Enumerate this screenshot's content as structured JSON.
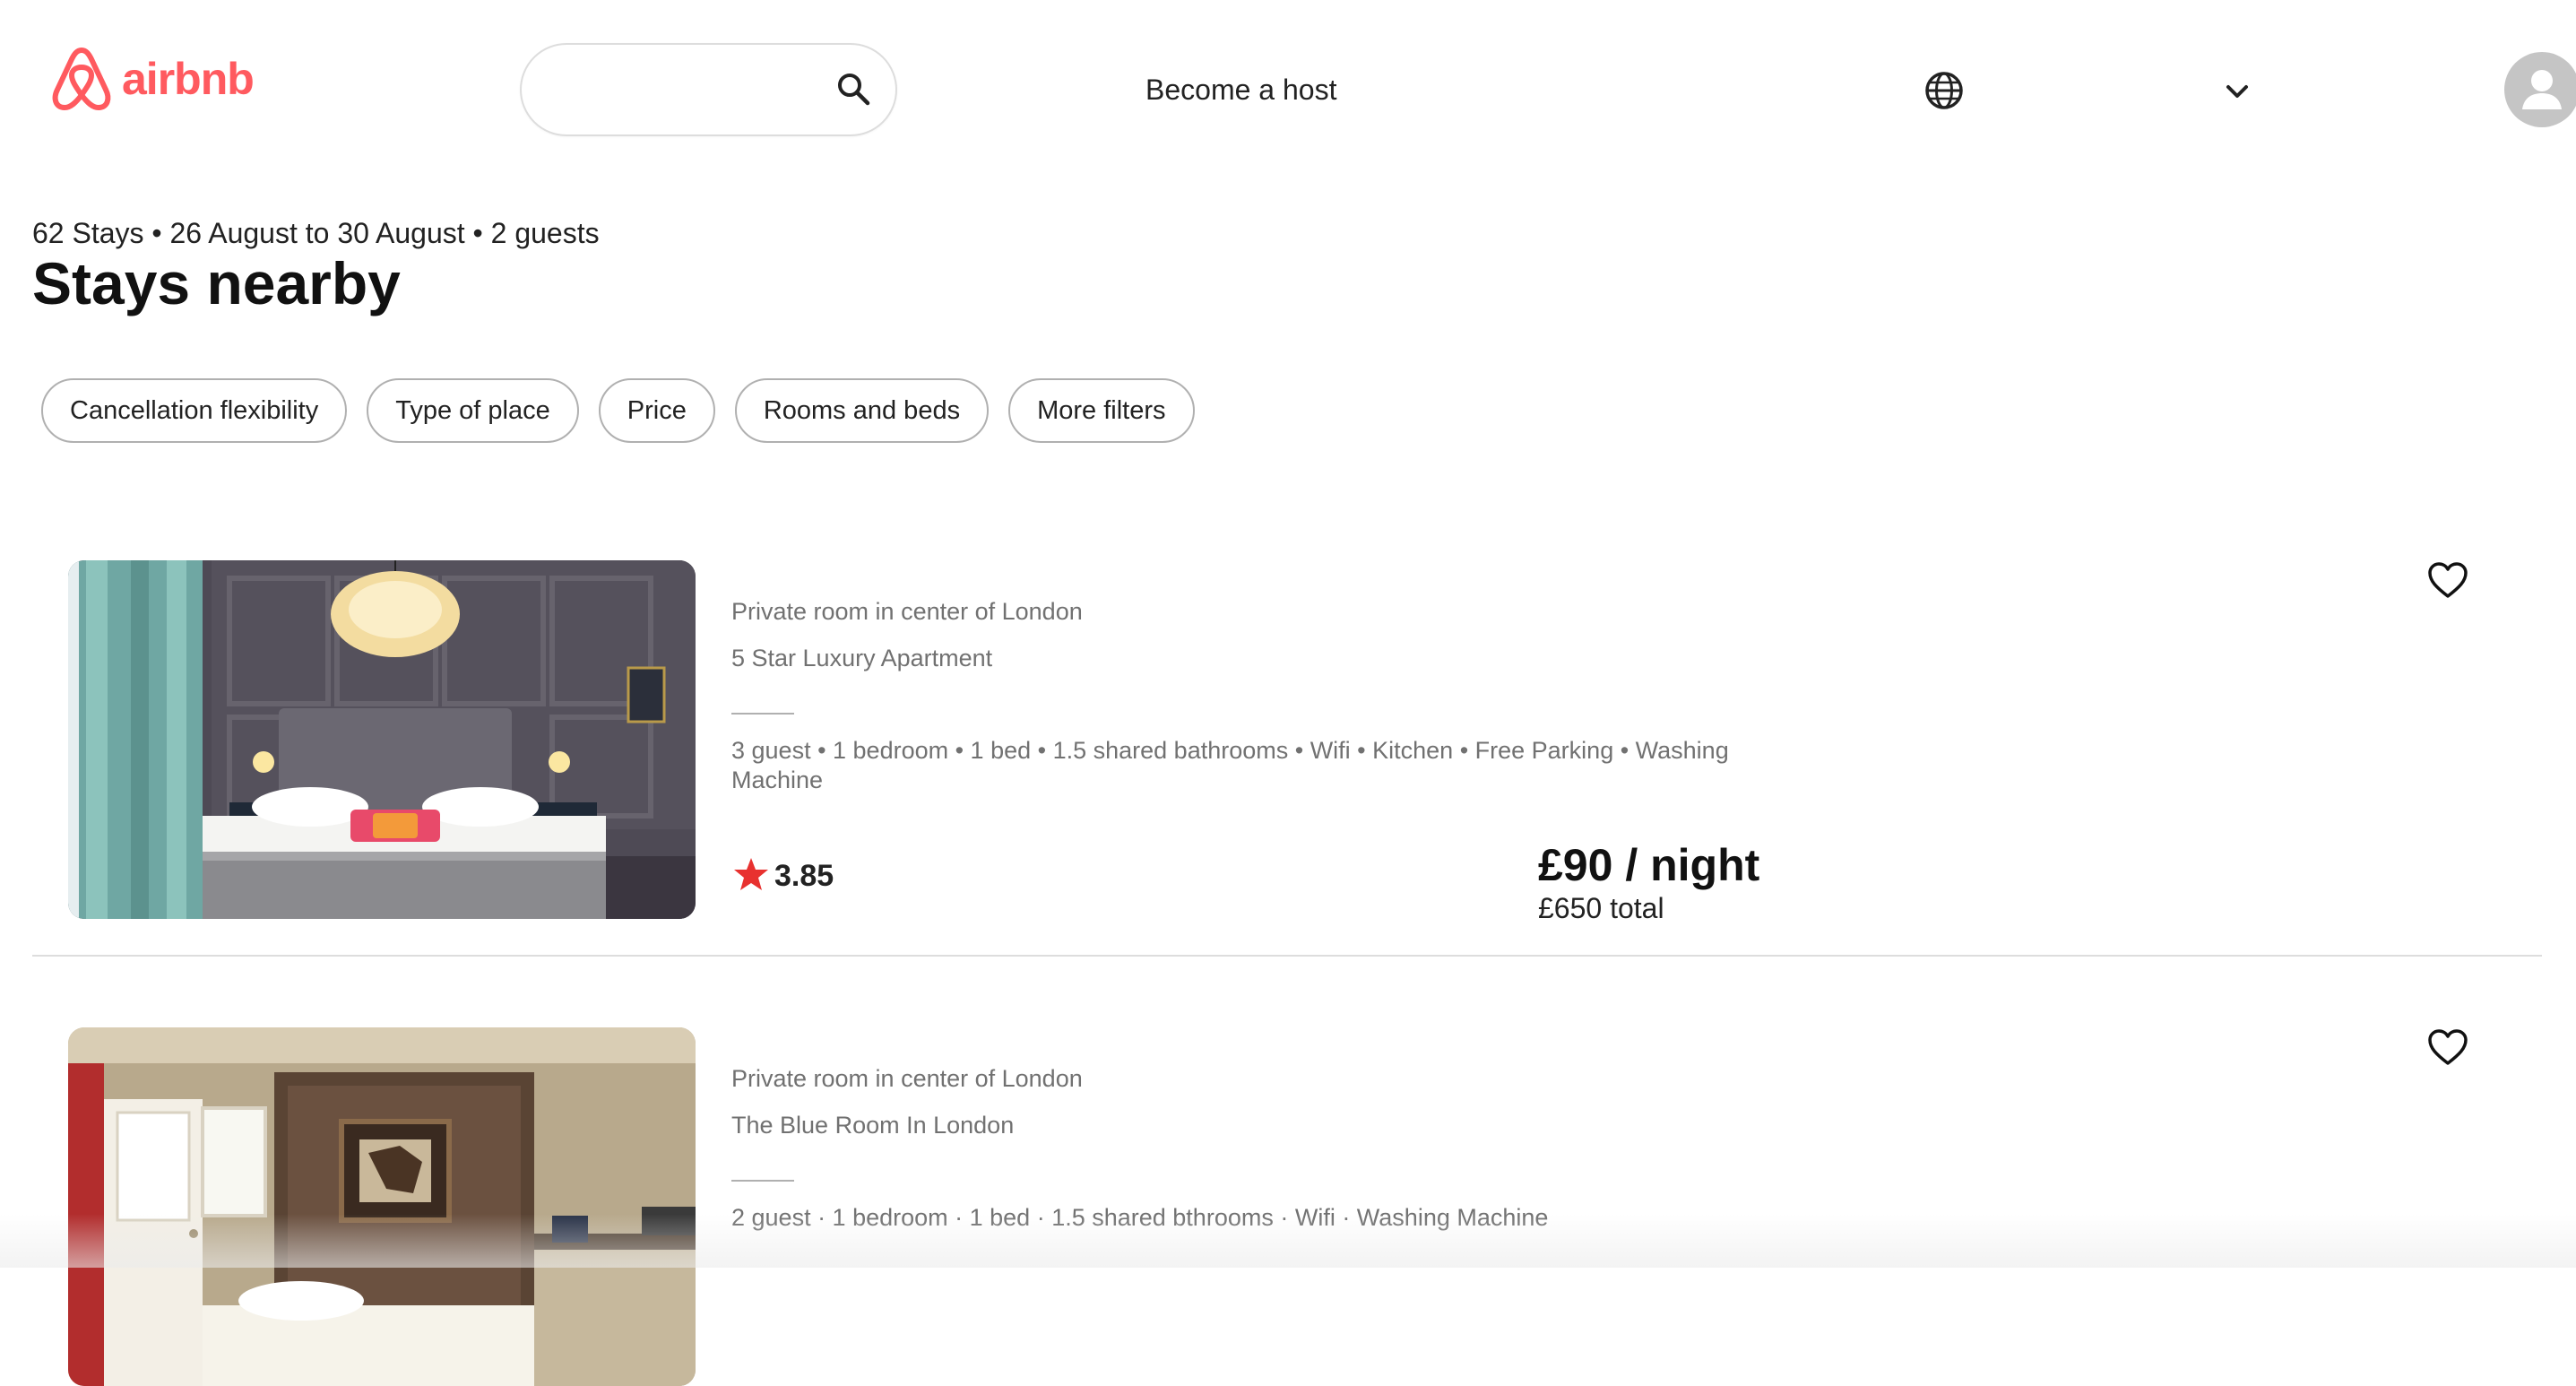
{
  "header": {
    "logo_text": "airbnb",
    "search": {
      "placeholder": "",
      "value": ""
    },
    "become_host_label": "Become a host",
    "icons": [
      "airbnb-logo-icon",
      "search-icon",
      "globe-icon",
      "chevron-down-icon",
      "user-icon"
    ]
  },
  "results": {
    "summary": "62 Stays • 26 August to 30 August • 2 guests",
    "title": "Stays nearby"
  },
  "filters": [
    "Cancellation flexibility",
    "Type of place",
    "Price",
    "Rooms and beds",
    "More filters"
  ],
  "listings": [
    {
      "subtitle": "Private room in center of London",
      "title": "5 Star Luxury Apartment",
      "amenities": "3 guest • 1 bedroom • 1 bed • 1.5 shared bathrooms • Wifi • Kitchen • Free Parking • Washing Machine",
      "rating": "3.85",
      "price_night": "£90 / night",
      "price_total": "£650 total"
    },
    {
      "subtitle": "Private room in center of London",
      "title": "The Blue Room In London",
      "amenities": "2 guest · 1 bedroom · 1 bed · 1.5 shared bthrooms · Wifi · Washing Machine"
    }
  ],
  "colors": {
    "brand": "#FF5A5F",
    "star": "#E8312F",
    "muted_text": "#717171",
    "border": "#B0B0B0"
  }
}
